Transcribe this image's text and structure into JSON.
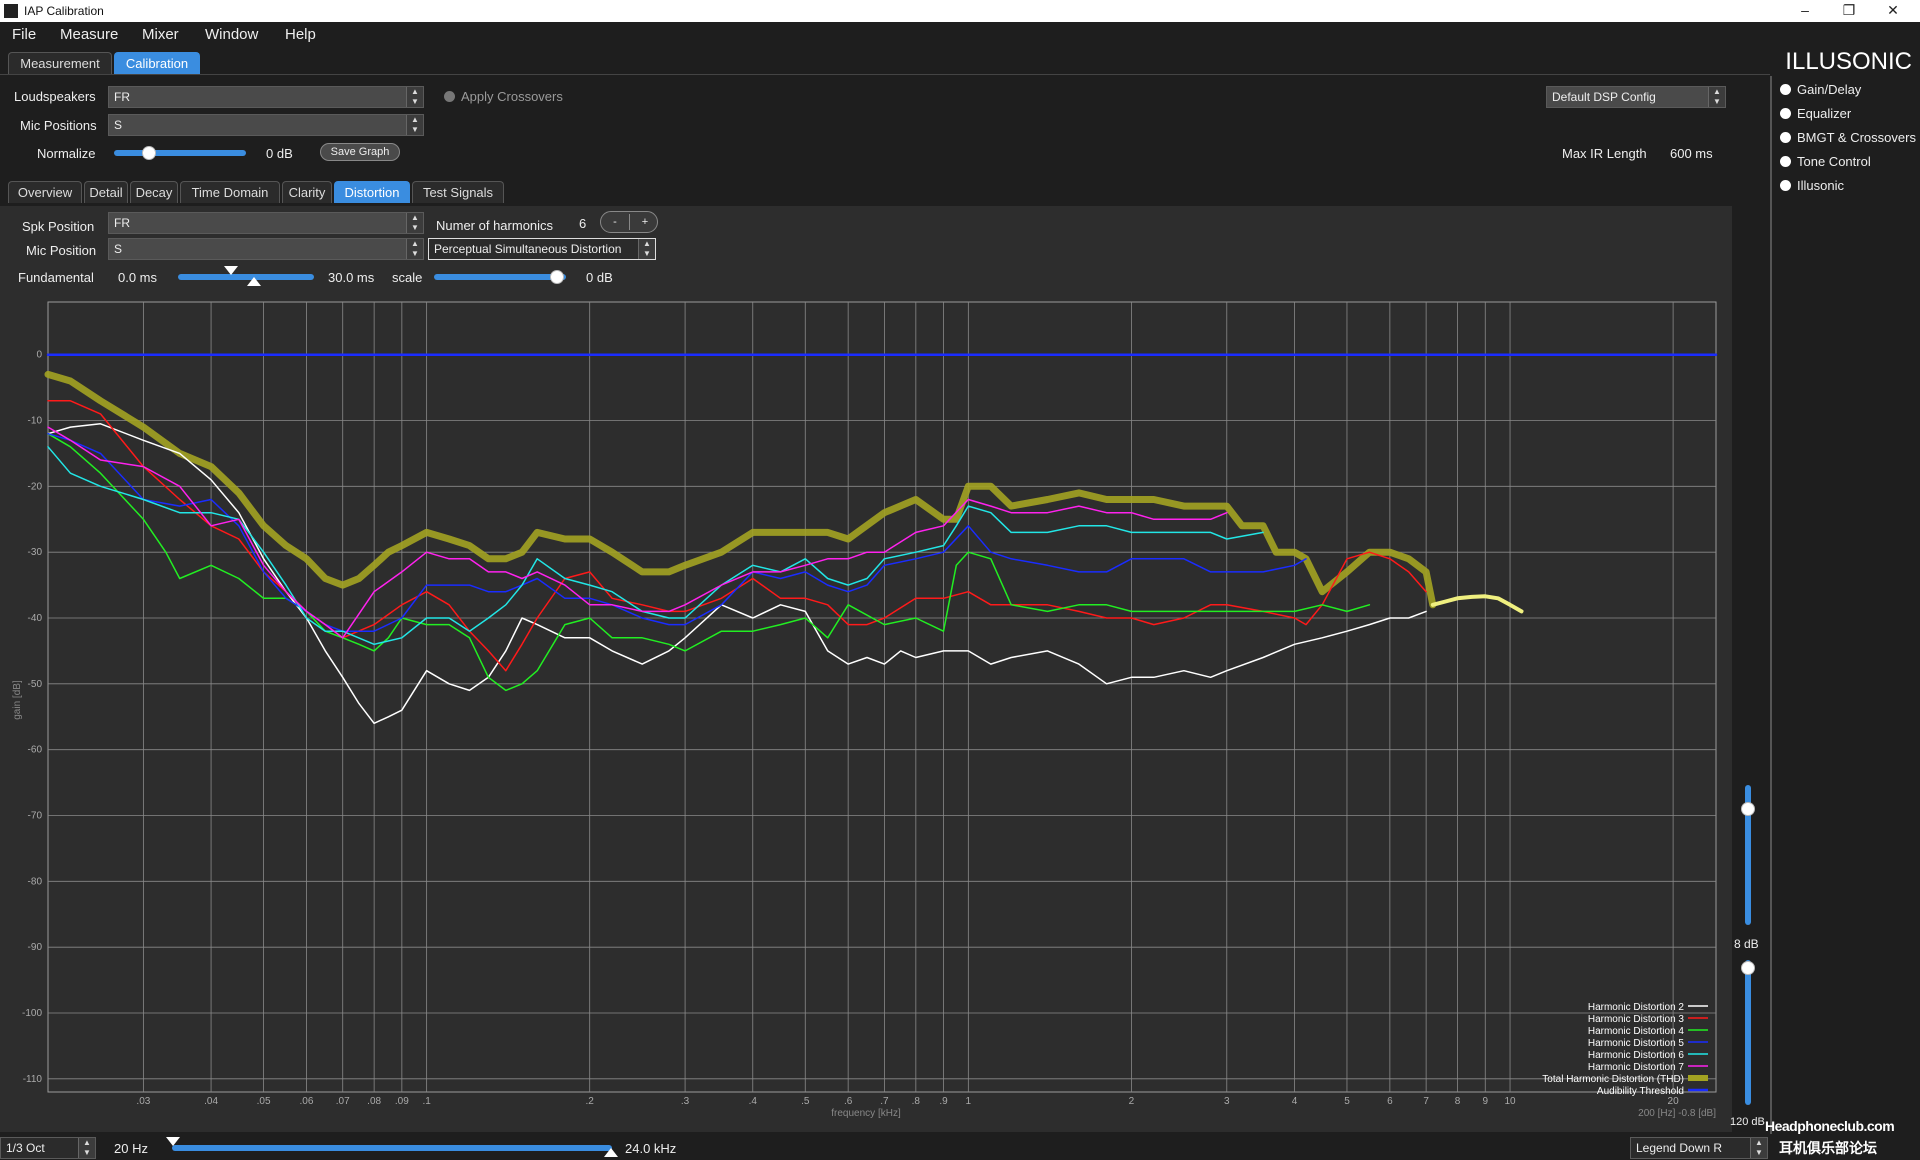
{
  "window": {
    "title": "IAP Calibration",
    "controls": {
      "minimize": "–",
      "maximize": "❐",
      "close": "✕"
    }
  },
  "menu": [
    "File",
    "Measure",
    "Mixer",
    "Window",
    "Help"
  ],
  "brand": "ILLUSONIC",
  "top_tabs": [
    {
      "label": "Measurement",
      "active": false
    },
    {
      "label": "Calibration",
      "active": true
    }
  ],
  "controls": {
    "loudspeakers_label": "Loudspeakers",
    "loudspeakers_value": "FR",
    "mic_positions_label": "Mic Positions",
    "mic_positions_value": "S",
    "apply_crossovers": "Apply Crossovers",
    "normalize_label": "Normalize",
    "normalize_value": "0 dB",
    "save_graph": "Save Graph",
    "dsp_config": "Default DSP Config",
    "max_ir_label": "Max IR Length",
    "max_ir_value": "600 ms"
  },
  "right_menu": [
    "Gain/Delay",
    "Equalizer",
    "BMGT & Crossovers",
    "Tone Control",
    "Illusonic"
  ],
  "sub_tabs": [
    {
      "label": "Overview",
      "active": false
    },
    {
      "label": "Detail",
      "active": false
    },
    {
      "label": "Decay",
      "active": false
    },
    {
      "label": "Time Domain",
      "active": false
    },
    {
      "label": "Clarity",
      "active": false
    },
    {
      "label": "Distortion",
      "active": true
    },
    {
      "label": "Test Signals",
      "active": false
    }
  ],
  "distortion": {
    "spk_position_label": "Spk Position",
    "spk_position_value": "FR",
    "mic_position_label": "Mic Position",
    "mic_position_value": "S",
    "harmonics_label": "Numer of harmonics",
    "harmonics_value": "6",
    "minus": "-",
    "plus": "+",
    "mode": "Perceptual Simultaneous Distortion",
    "fundamental_label": "Fundamental",
    "fundamental_from": "0.0 ms",
    "fundamental_to": "30.0 ms",
    "scale_label": "scale",
    "scale_value": "0 dB"
  },
  "right_slider": {
    "label_mid": "8 dB",
    "label_bottom": "120 dB"
  },
  "bottom": {
    "octave": "1/3 Oct",
    "freq_min": "20 Hz",
    "freq_max": "24.0 kHz",
    "legend_pos": "Legend Down R"
  },
  "watermark": {
    "text": "Headphoneclub.com",
    "sub": "耳机俱乐部论坛"
  },
  "corner_readout": "200 [Hz] -0.8 [dB]",
  "chart_data": {
    "type": "line",
    "title": "",
    "xlabel": "frequency [kHz]",
    "ylabel": "gain [dB]",
    "x_scale": "log",
    "xlim": [
      0.02,
      24
    ],
    "ylim": [
      -112,
      8
    ],
    "y_ticks": [
      0,
      -10,
      -20,
      -30,
      -40,
      -50,
      -60,
      -70,
      -80,
      -90,
      -100,
      -110
    ],
    "x_ticks": [
      {
        "v": 0.03,
        "t": ".03"
      },
      {
        "v": 0.04,
        "t": ".04"
      },
      {
        "v": 0.05,
        "t": ".05"
      },
      {
        "v": 0.06,
        "t": ".06"
      },
      {
        "v": 0.07,
        "t": ".07"
      },
      {
        "v": 0.08,
        "t": ".08"
      },
      {
        "v": 0.09,
        "t": ".09"
      },
      {
        "v": 0.1,
        "t": ".1"
      },
      {
        "v": 0.2,
        "t": ".2"
      },
      {
        "v": 0.3,
        "t": ".3"
      },
      {
        "v": 0.4,
        "t": ".4"
      },
      {
        "v": 0.5,
        "t": ".5"
      },
      {
        "v": 0.6,
        "t": ".6"
      },
      {
        "v": 0.7,
        "t": ".7"
      },
      {
        "v": 0.8,
        "t": ".8"
      },
      {
        "v": 0.9,
        "t": ".9"
      },
      {
        "v": 1,
        "t": "1"
      },
      {
        "v": 2,
        "t": "2"
      },
      {
        "v": 3,
        "t": "3"
      },
      {
        "v": 4,
        "t": "4"
      },
      {
        "v": 5,
        "t": "5"
      },
      {
        "v": 6,
        "t": "6"
      },
      {
        "v": 7,
        "t": "7"
      },
      {
        "v": 8,
        "t": "8"
      },
      {
        "v": 9,
        "t": "9"
      },
      {
        "v": 10,
        "t": "10"
      },
      {
        "v": 20,
        "t": "20"
      }
    ],
    "grid": true,
    "legend_placement": "bottom-right",
    "series": [
      {
        "name": "Harmonic Distortion 2",
        "color": "#ffffff",
        "width": 1.5,
        "x": [
          0.02,
          0.022,
          0.025,
          0.03,
          0.035,
          0.04,
          0.045,
          0.05,
          0.055,
          0.06,
          0.065,
          0.07,
          0.075,
          0.08,
          0.085,
          0.09,
          0.1,
          0.11,
          0.12,
          0.13,
          0.14,
          0.15,
          0.16,
          0.18,
          0.2,
          0.22,
          0.25,
          0.28,
          0.3,
          0.35,
          0.4,
          0.45,
          0.5,
          0.55,
          0.6,
          0.65,
          0.7,
          0.75,
          0.8,
          0.9,
          1,
          1.1,
          1.2,
          1.4,
          1.6,
          1.8,
          2,
          2.2,
          2.5,
          2.8,
          3,
          3.5,
          4,
          4.5,
          5,
          5.5,
          6,
          6.5,
          7
        ],
        "y": [
          -12,
          -11,
          -10.5,
          -13,
          -15,
          -19,
          -24,
          -31,
          -36,
          -40,
          -45,
          -49,
          -53,
          -56,
          -55,
          -54,
          -48,
          -50,
          -51,
          -49,
          -45,
          -40,
          -41,
          -43,
          -43,
          -45,
          -47,
          -45,
          -43,
          -38,
          -40,
          -38,
          -39,
          -45,
          -47,
          -46,
          -47,
          -45,
          -46,
          -45,
          -45,
          -47,
          -46,
          -45,
          -47,
          -50,
          -49,
          -49,
          -48,
          -49,
          -48,
          -46,
          -44,
          -43,
          -42,
          -41,
          -40,
          -40,
          -39
        ]
      },
      {
        "name": "Harmonic Distortion 3",
        "color": "#ff1a1a",
        "width": 1.5,
        "x": [
          0.02,
          0.022,
          0.025,
          0.03,
          0.035,
          0.04,
          0.045,
          0.05,
          0.055,
          0.06,
          0.065,
          0.07,
          0.08,
          0.09,
          0.1,
          0.11,
          0.12,
          0.13,
          0.14,
          0.15,
          0.16,
          0.18,
          0.2,
          0.22,
          0.25,
          0.28,
          0.3,
          0.35,
          0.4,
          0.45,
          0.5,
          0.55,
          0.6,
          0.65,
          0.7,
          0.8,
          0.9,
          1,
          1.1,
          1.2,
          1.4,
          1.6,
          1.8,
          2,
          2.2,
          2.5,
          2.8,
          3,
          3.5,
          4,
          4.2,
          4.5,
          5,
          5.5,
          6,
          6.5,
          7
        ],
        "y": [
          -7,
          -7,
          -9,
          -17,
          -22,
          -26,
          -28,
          -33,
          -36,
          -39,
          -41,
          -43,
          -41,
          -38,
          -36,
          -38,
          -42,
          -45,
          -48,
          -44,
          -40,
          -34,
          -33,
          -37,
          -38,
          -39,
          -39,
          -37,
          -34,
          -37,
          -37,
          -38,
          -41,
          -41,
          -40,
          -37,
          -37,
          -36,
          -38,
          -38,
          -38,
          -39,
          -40,
          -40,
          -41,
          -40,
          -38,
          -38,
          -39,
          -40,
          -41,
          -38,
          -31,
          -30,
          -31,
          -33,
          -36
        ]
      },
      {
        "name": "Harmonic Distortion 4",
        "color": "#22ee22",
        "width": 1.5,
        "x": [
          0.02,
          0.022,
          0.025,
          0.03,
          0.033,
          0.035,
          0.04,
          0.045,
          0.05,
          0.055,
          0.06,
          0.065,
          0.07,
          0.075,
          0.08,
          0.085,
          0.09,
          0.1,
          0.11,
          0.12,
          0.13,
          0.14,
          0.15,
          0.16,
          0.18,
          0.2,
          0.22,
          0.25,
          0.28,
          0.3,
          0.35,
          0.4,
          0.45,
          0.5,
          0.55,
          0.6,
          0.7,
          0.8,
          0.9,
          0.95,
          1,
          1.1,
          1.2,
          1.4,
          1.6,
          1.8,
          2,
          2.2,
          2.5,
          2.8,
          3,
          3.5,
          4,
          4.5,
          5,
          5.5
        ],
        "y": [
          -12,
          -14,
          -18,
          -25,
          -30,
          -34,
          -32,
          -34,
          -37,
          -37,
          -39,
          -42,
          -43,
          -44,
          -45,
          -43,
          -40,
          -41,
          -41,
          -43,
          -49,
          -51,
          -50,
          -48,
          -41,
          -40,
          -43,
          -43,
          -44,
          -45,
          -42,
          -42,
          -41,
          -40,
          -43,
          -38,
          -41,
          -40,
          -42,
          -32,
          -30,
          -31,
          -38,
          -39,
          -38,
          -38,
          -39,
          -39,
          -39,
          -39,
          -39,
          -39,
          -39,
          -38,
          -39,
          -38
        ]
      },
      {
        "name": "Harmonic Distortion 5",
        "color": "#1a2cff",
        "width": 1.5,
        "x": [
          0.02,
          0.022,
          0.025,
          0.03,
          0.035,
          0.04,
          0.045,
          0.05,
          0.055,
          0.06,
          0.065,
          0.07,
          0.08,
          0.09,
          0.1,
          0.11,
          0.12,
          0.13,
          0.14,
          0.15,
          0.16,
          0.18,
          0.2,
          0.22,
          0.25,
          0.28,
          0.3,
          0.35,
          0.4,
          0.45,
          0.5,
          0.55,
          0.6,
          0.65,
          0.7,
          0.8,
          0.9,
          1,
          1.1,
          1.2,
          1.4,
          1.6,
          1.8,
          2,
          2.2,
          2.5,
          2.8,
          3,
          3.5,
          4,
          4.2
        ],
        "y": [
          -12,
          -13,
          -15,
          -22,
          -23,
          -22,
          -26,
          -33,
          -37,
          -39,
          -41,
          -42,
          -42,
          -40,
          -35,
          -35,
          -35,
          -36,
          -36,
          -35,
          -34,
          -37,
          -37,
          -38,
          -40,
          -41,
          -41,
          -38,
          -33,
          -34,
          -33,
          -35,
          -36,
          -35,
          -32,
          -31,
          -30,
          -26,
          -30,
          -31,
          -32,
          -33,
          -33,
          -31,
          -31,
          -31,
          -33,
          -33,
          -33,
          -32,
          -31
        ]
      },
      {
        "name": "Harmonic Distortion 6",
        "color": "#22e6e6",
        "width": 1.5,
        "x": [
          0.02,
          0.022,
          0.025,
          0.03,
          0.035,
          0.04,
          0.045,
          0.05,
          0.055,
          0.06,
          0.065,
          0.07,
          0.08,
          0.09,
          0.1,
          0.11,
          0.12,
          0.13,
          0.14,
          0.15,
          0.16,
          0.18,
          0.2,
          0.22,
          0.25,
          0.28,
          0.3,
          0.35,
          0.4,
          0.45,
          0.5,
          0.55,
          0.6,
          0.65,
          0.7,
          0.8,
          0.9,
          0.95,
          1,
          1.1,
          1.2,
          1.4,
          1.6,
          1.8,
          2,
          2.2,
          2.5,
          2.8,
          3,
          3.5
        ],
        "y": [
          -14,
          -18,
          -20,
          -22,
          -24,
          -24,
          -25,
          -30,
          -35,
          -40,
          -42,
          -42,
          -44,
          -43,
          -40,
          -40,
          -42,
          -40,
          -38,
          -35,
          -31,
          -34,
          -35,
          -36,
          -39,
          -40,
          -40,
          -35,
          -32,
          -33,
          -31,
          -34,
          -35,
          -34,
          -31,
          -30,
          -29,
          -26,
          -23,
          -24,
          -27,
          -27,
          -26,
          -26,
          -27,
          -27,
          -27,
          -27,
          -28,
          -27
        ]
      },
      {
        "name": "Harmonic Distortion 7",
        "color": "#ff22ee",
        "width": 1.5,
        "x": [
          0.02,
          0.022,
          0.025,
          0.03,
          0.035,
          0.04,
          0.045,
          0.05,
          0.055,
          0.06,
          0.065,
          0.07,
          0.08,
          0.09,
          0.1,
          0.11,
          0.12,
          0.13,
          0.14,
          0.15,
          0.16,
          0.18,
          0.2,
          0.22,
          0.25,
          0.28,
          0.3,
          0.35,
          0.4,
          0.45,
          0.5,
          0.55,
          0.6,
          0.65,
          0.7,
          0.8,
          0.9,
          1,
          1.1,
          1.2,
          1.4,
          1.6,
          1.8,
          2,
          2.2,
          2.5,
          2.8,
          3
        ],
        "y": [
          -11,
          -13,
          -16,
          -17,
          -20,
          -26,
          -25,
          -32,
          -36,
          -39,
          -41,
          -43,
          -36,
          -33,
          -30,
          -31,
          -31,
          -33,
          -33,
          -34,
          -33,
          -35,
          -38,
          -38,
          -39,
          -39,
          -38,
          -35,
          -33,
          -33,
          -32,
          -31,
          -31,
          -30,
          -30,
          -27,
          -26,
          -22,
          -23,
          -24,
          -24,
          -23,
          -24,
          -24,
          -25,
          -25,
          -25,
          -24
        ]
      },
      {
        "name": "Total Harmonic Distortion (THD)",
        "color": "#a3a322",
        "width": 7,
        "x": [
          0.02,
          0.022,
          0.025,
          0.03,
          0.035,
          0.04,
          0.045,
          0.05,
          0.055,
          0.06,
          0.065,
          0.07,
          0.075,
          0.08,
          0.085,
          0.09,
          0.1,
          0.11,
          0.12,
          0.13,
          0.14,
          0.15,
          0.16,
          0.18,
          0.2,
          0.22,
          0.25,
          0.28,
          0.3,
          0.35,
          0.4,
          0.45,
          0.5,
          0.55,
          0.6,
          0.7,
          0.8,
          0.9,
          0.95,
          1,
          1.1,
          1.2,
          1.4,
          1.6,
          1.8,
          2,
          2.2,
          2.5,
          2.8,
          3,
          3.2,
          3.5,
          3.7,
          4,
          4.2,
          4.5,
          5,
          5.5,
          6,
          6.5,
          7,
          7.2
        ],
        "y": [
          -3,
          -4,
          -7,
          -11,
          -15,
          -17,
          -21,
          -26,
          -29,
          -31,
          -34,
          -35,
          -34,
          -32,
          -30,
          -29,
          -27,
          -28,
          -29,
          -31,
          -31,
          -30,
          -27,
          -28,
          -28,
          -30,
          -33,
          -33,
          -32,
          -30,
          -27,
          -27,
          -27,
          -27,
          -28,
          -24,
          -22,
          -25,
          -25,
          -20,
          -20,
          -23,
          -22,
          -21,
          -22,
          -22,
          -22,
          -23,
          -23,
          -23,
          -26,
          -26,
          -30,
          -30,
          -31,
          -36,
          -33,
          -30,
          -30,
          -31,
          -33,
          -38
        ]
      },
      {
        "name": "Audibility Threshold",
        "color": "#1a2cff",
        "width": 2.5,
        "x": [
          0.02,
          24
        ],
        "y": [
          0,
          0
        ]
      }
    ],
    "extra_series_unlabeled": [
      {
        "color": "#f0f080",
        "width": 4,
        "x": [
          7.2,
          7.6,
          8,
          8.5,
          9,
          9.5,
          10,
          10.5
        ],
        "y": [
          -38,
          -37.5,
          -37,
          -36.8,
          -36.7,
          -37,
          -38,
          -39
        ]
      }
    ]
  }
}
